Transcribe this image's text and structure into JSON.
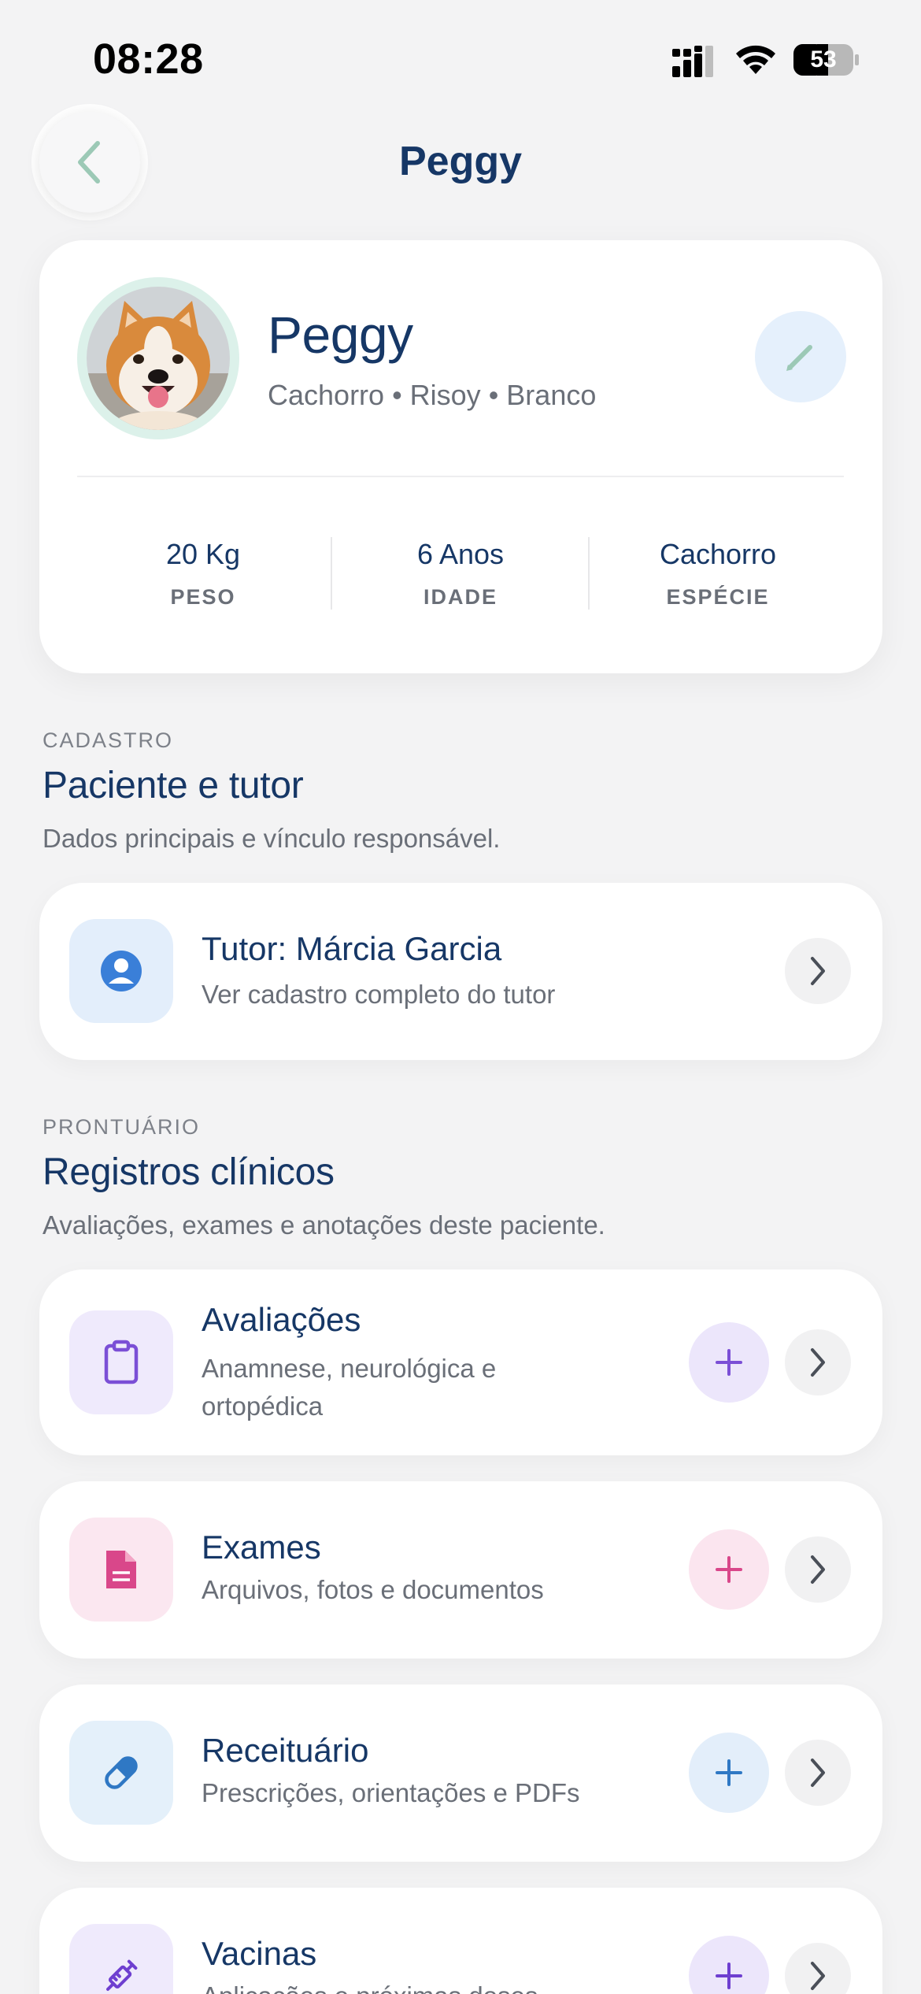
{
  "status_bar": {
    "time": "08:28",
    "battery_level": "53",
    "icons": [
      "signal-icon",
      "wifi-icon",
      "battery-icon"
    ]
  },
  "header": {
    "title": "Peggy",
    "back_icon": "chevron-left-icon"
  },
  "profile": {
    "name": "Peggy",
    "meta": "Cachorro • Risoy • Branco",
    "edit_icon": "pencil-icon",
    "stats": [
      {
        "value": "20 Kg",
        "label": "PESO"
      },
      {
        "value": "6 Anos",
        "label": "IDADE"
      },
      {
        "value": "Cachorro",
        "label": "ESPÉCIE"
      }
    ]
  },
  "section_cadastro": {
    "eyebrow": "CADASTRO",
    "title": "Paciente e tutor",
    "subtitle": "Dados principais e vínculo responsável."
  },
  "tutor_card": {
    "title": "Tutor: Márcia Garcia",
    "subtitle": "Ver cadastro completo do tutor",
    "icon": "user-circle-icon"
  },
  "section_prontuario": {
    "eyebrow": "PRONTUÁRIO",
    "title": "Registros clínicos",
    "subtitle": "Avaliações, exames e anotações deste paciente."
  },
  "records": [
    {
      "title": "Avaliações",
      "subtitle_line1": "Anamnese, neurológica e",
      "subtitle_line2": "ortopédica",
      "icon": "clipboard-icon",
      "accent": "#7b4fd6",
      "icon_bg": "#efeafc",
      "add_bg": "#ece6fb"
    },
    {
      "title": "Exames",
      "subtitle_line1": "Arquivos, fotos e documentos",
      "subtitle_line2": "",
      "icon": "document-icon",
      "accent": "#d9478a",
      "icon_bg": "#fbe7f0",
      "add_bg": "#fbe5ef"
    },
    {
      "title": "Receituário",
      "subtitle_line1": "Prescrições, orientações e PDFs",
      "subtitle_line2": "",
      "icon": "pill-icon",
      "accent": "#2f78c4",
      "icon_bg": "#e4f0fa",
      "add_bg": "#e3eefa"
    },
    {
      "title": "Vacinas",
      "subtitle_line1": "Aplicações e próximas doses",
      "subtitle_line2": "",
      "icon": "syringe-icon",
      "accent": "#6e3fd0",
      "icon_bg": "#efeafc",
      "add_bg": "#ece6fb"
    }
  ]
}
